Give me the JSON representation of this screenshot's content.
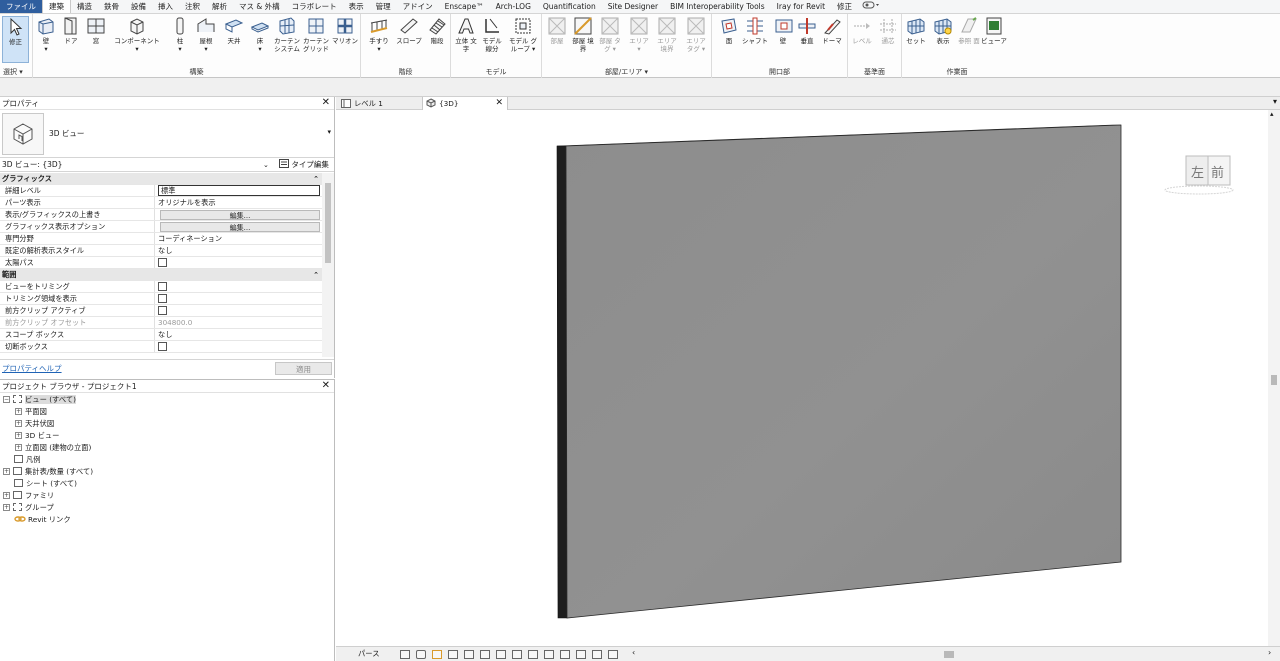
{
  "menu": {
    "tabs": [
      "ファイル",
      "建築",
      "構造",
      "鉄骨",
      "設備",
      "挿入",
      "注釈",
      "解析",
      "マス & 外構",
      "コラボレート",
      "表示",
      "管理",
      "アドイン",
      "Enscape™",
      "Arch-LOG",
      "Quantification",
      "Site Designer",
      "BIM Interoperability Tools",
      "Iray for Revit",
      "修正"
    ]
  },
  "ribbon": {
    "modify": "修正",
    "select": "選択",
    "build": {
      "label": "構築",
      "items": [
        "壁",
        "ドア",
        "窓",
        "コンポーネント",
        "柱",
        "屋根",
        "天井",
        "床",
        "カーテン システム",
        "カーテン グリッド",
        "マリオン"
      ]
    },
    "circulation": {
      "label": "階段",
      "items": [
        "手すり",
        "スロープ",
        "階段"
      ]
    },
    "model": {
      "label": "モデル",
      "items": [
        "立体 文字",
        "モデル 線分",
        "モデル グループ"
      ]
    },
    "room": {
      "label": "部屋/エリア",
      "items": [
        "部屋",
        "部屋 境界",
        "部屋 タグ",
        "エリア",
        "エリア 境界",
        "エリア タグ"
      ]
    },
    "opening": {
      "label": "開口部",
      "items": [
        "面",
        "シャフト",
        "壁",
        "垂直",
        "ドーマ"
      ]
    },
    "datum": {
      "label": "基準面",
      "items": [
        "レベル",
        "通芯"
      ]
    },
    "workplane": {
      "label": "作業面",
      "items": [
        "セット",
        "表示",
        "参照 面",
        "ビューア"
      ]
    }
  },
  "properties": {
    "title": "プロパティ",
    "type_name": "3D ビュー",
    "instance": "3D ビュー: {3D}",
    "type_edit": "タイプ編集",
    "categories": [
      {
        "name": "グラフィックス",
        "rows": [
          {
            "name": "詳細レベル",
            "value": "標準"
          },
          {
            "name": "パーツ表示",
            "value": "オリジナルを表示"
          },
          {
            "name": "表示/グラフィックスの上書き",
            "value": "編集..."
          },
          {
            "name": "グラフィックス表示オプション",
            "value": "編集..."
          },
          {
            "name": "専門分野",
            "value": "コーディネーション"
          },
          {
            "name": "既定の解析表示スタイル",
            "value": "なし"
          },
          {
            "name": "太陽パス",
            "value": ""
          }
        ]
      },
      {
        "name": "範囲",
        "rows": [
          {
            "name": "ビューをトリミング",
            "value": ""
          },
          {
            "name": "トリミング領域を表示",
            "value": ""
          },
          {
            "name": "前方クリップ アクティブ",
            "value": ""
          },
          {
            "name": "前方クリップ オフセット",
            "value": "304800.0"
          },
          {
            "name": "スコープ ボックス",
            "value": "なし"
          },
          {
            "name": "切断ボックス",
            "value": ""
          }
        ]
      }
    ],
    "help": "プロパティヘルプ",
    "apply": "適用"
  },
  "browser": {
    "title": "プロジェクト ブラウザ - プロジェクト1",
    "tree": [
      {
        "label": "ビュー (すべて)",
        "toggle": "−"
      },
      {
        "label": "平面図",
        "toggle": "+"
      },
      {
        "label": "天井伏図",
        "toggle": "+"
      },
      {
        "label": "3D ビュー",
        "toggle": "+"
      },
      {
        "label": "立面図 (建物の立面)",
        "toggle": "+"
      },
      {
        "label": "凡例",
        "toggle": ""
      },
      {
        "label": "集計表/数量 (すべて)",
        "toggle": "+"
      },
      {
        "label": "シート (すべて)",
        "toggle": ""
      },
      {
        "label": "ファミリ",
        "toggle": "+"
      },
      {
        "label": "グループ",
        "toggle": "+"
      },
      {
        "label": "Revit リンク",
        "toggle": ""
      }
    ]
  },
  "view": {
    "tabs": [
      "レベル 1",
      "{3D}"
    ],
    "viewcube_left": "左",
    "viewcube_front": "前",
    "scale_label": "パース",
    "wall_color": "#8f8f8f"
  }
}
